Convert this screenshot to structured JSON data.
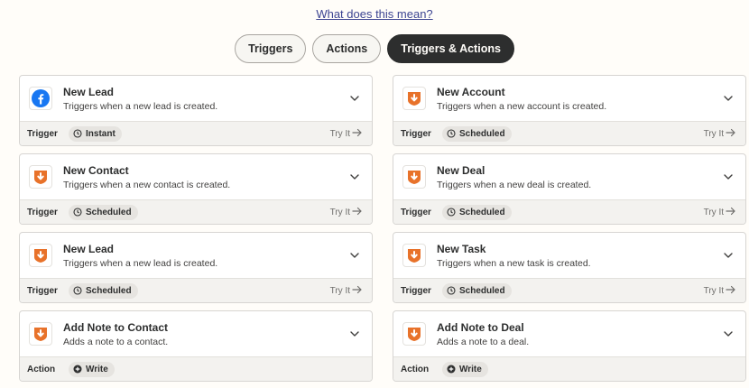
{
  "header": {
    "link_text": "What does this mean?"
  },
  "filters": [
    {
      "label": "Triggers",
      "active": false
    },
    {
      "label": "Actions",
      "active": false
    },
    {
      "label": "Triggers & Actions",
      "active": true
    }
  ],
  "cards": [
    {
      "icon": "facebook-icon",
      "title": "New Lead",
      "description": "Triggers when a new lead is created.",
      "type": "Trigger",
      "badge_icon": "clock-icon",
      "badge": "Instant",
      "try_label": "Try It"
    },
    {
      "icon": "app-arrow-icon",
      "title": "New Account",
      "description": "Triggers when a new account is created.",
      "type": "Trigger",
      "badge_icon": "clock-icon",
      "badge": "Scheduled",
      "try_label": "Try It"
    },
    {
      "icon": "app-arrow-icon",
      "title": "New Contact",
      "description": "Triggers when a new contact is created.",
      "type": "Trigger",
      "badge_icon": "clock-icon",
      "badge": "Scheduled",
      "try_label": "Try It"
    },
    {
      "icon": "app-arrow-icon",
      "title": "New Deal",
      "description": "Triggers when a new deal is created.",
      "type": "Trigger",
      "badge_icon": "clock-icon",
      "badge": "Scheduled",
      "try_label": "Try It"
    },
    {
      "icon": "app-arrow-icon",
      "title": "New Lead",
      "description": "Triggers when a new lead is created.",
      "type": "Trigger",
      "badge_icon": "clock-icon",
      "badge": "Scheduled",
      "try_label": "Try It"
    },
    {
      "icon": "app-arrow-icon",
      "title": "New Task",
      "description": "Triggers when a new task is created.",
      "type": "Trigger",
      "badge_icon": "clock-icon",
      "badge": "Scheduled",
      "try_label": "Try It"
    },
    {
      "icon": "app-arrow-icon",
      "title": "Add Note to Contact",
      "description": "Adds a note to a contact.",
      "type": "Action",
      "badge_icon": "plus-circle-icon",
      "badge": "Write",
      "try_label": ""
    },
    {
      "icon": "app-arrow-icon",
      "title": "Add Note to Deal",
      "description": "Adds a note to a deal.",
      "type": "Action",
      "badge_icon": "plus-circle-icon",
      "badge": "Write",
      "try_label": ""
    }
  ],
  "colors": {
    "facebook": "#1877f2",
    "app_orange": "#e8722a",
    "dark_pill": "#2d2e2e",
    "link": "#3d4592"
  }
}
